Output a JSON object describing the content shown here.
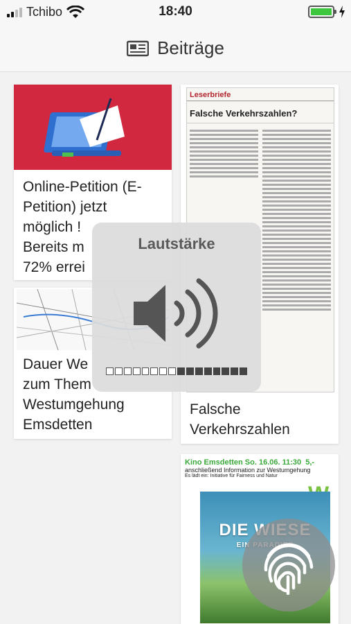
{
  "status_bar": {
    "carrier": "Tchibo",
    "time": "18:40",
    "battery_level": 1.0,
    "signal_bars": 2
  },
  "nav": {
    "title": "Beiträge",
    "icon": "newspaper-icon"
  },
  "posts": [
    {
      "title_lines": [
        "Online-Petition (E-",
        "Petition) jetzt",
        "möglich !",
        "Bereits m",
        "72% errei"
      ],
      "image": "laptop-petition-illustration"
    },
    {
      "title_lines": [
        "Dauer We",
        "zum Them",
        "Westumgehung",
        "Emsdetten"
      ],
      "image": "street-map"
    },
    {
      "title_lines": [
        "Falsche",
        "Verkehrszahlen"
      ],
      "image": "newspaper-clipping",
      "clipping": {
        "section": "Leserbriefe",
        "headline": "Falsche Verkehrszahlen?"
      }
    },
    {
      "image": "cinema-poster",
      "poster": {
        "headline": "Kino Emsdetten So. 16.06. 11:30",
        "price": "5,-",
        "subline": "anschließend Information zur Westumgehung",
        "small": "Es lädt ein: Initiative für Fairness und Natur",
        "movie": "DIE WIESE",
        "movie_sub": "EIN PARADIES"
      }
    }
  ],
  "volume_hud": {
    "title": "Lautstärke",
    "level": 0.5,
    "icon": "speaker-icon"
  },
  "touch_id": {
    "icon": "fingerprint-icon"
  }
}
